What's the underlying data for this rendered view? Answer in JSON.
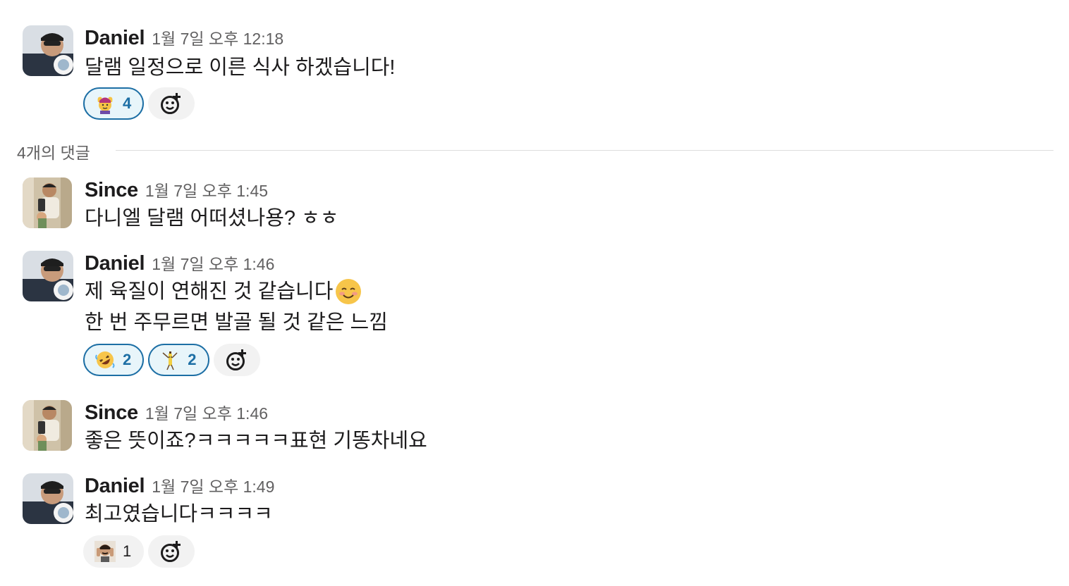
{
  "parent": {
    "author": "Daniel",
    "time": "1월 7일 오후 12:18",
    "text": "달램 일정으로 이른 식사 하겠습니다!",
    "reactions": [
      {
        "emoji": "woman-gesturing-ok",
        "count": "4",
        "active": true
      }
    ]
  },
  "thread": {
    "reply_count_label": "4개의 댓글"
  },
  "replies": [
    {
      "author": "Since",
      "time": "1월 7일 오후 1:45",
      "lines": [
        "다니엘 달램 어떠셨나용? ㅎㅎ"
      ]
    },
    {
      "author": "Daniel",
      "time": "1월 7일 오후 1:46",
      "lines": [
        "제 육질이 연해진 것 같습니다",
        "한 번 주무르면 발골 될 것 같은 느낌"
      ],
      "inline_emoji": "smiling-face",
      "reactions": [
        {
          "emoji": "rolling-on-the-floor-laughing",
          "count": "2",
          "active": true
        },
        {
          "emoji": "dancing-banana",
          "count": "2",
          "active": true
        }
      ]
    },
    {
      "author": "Since",
      "time": "1월 7일 오후 1:46",
      "lines": [
        "좋은 뜻이죠?ㅋㅋㅋㅋㅋ표현 기똥차네요"
      ]
    },
    {
      "author": "Daniel",
      "time": "1월 7일 오후 1:49",
      "lines": [
        "최고였습니다ㅋㅋㅋㅋ"
      ],
      "reactions": [
        {
          "emoji": "man-face-palm",
          "count": "1",
          "active": false
        }
      ]
    }
  ],
  "colors": {
    "reaction_active_bg": "#e8f5fa",
    "reaction_active_border": "#1d6fa5",
    "muted_text": "#616061",
    "pill_bg": "#f2f2f2"
  }
}
